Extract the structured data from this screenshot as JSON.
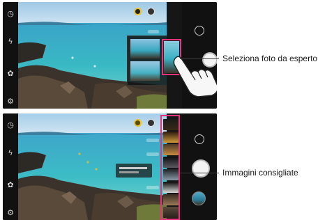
{
  "callouts": {
    "top_label": "Seleziona foto da esperto",
    "bottom_label": "Immagini consigliate"
  },
  "icons": {
    "timer": "timer-icon",
    "flash": "flash-off-icon",
    "effects": "effects-icon",
    "settings": "gear-icon",
    "switch_camera": "switch-camera-icon",
    "ai_cam": "ai-cam-icon",
    "mode": "mode-icon",
    "hand": "pointing-hand-icon"
  },
  "colors": {
    "highlight": "#e8337a",
    "ai_accent": "#e8c22a"
  }
}
